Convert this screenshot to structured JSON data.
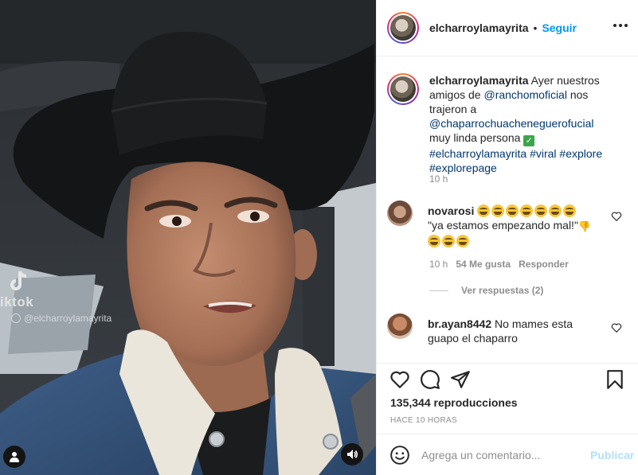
{
  "media": {
    "watermark_word": "iktok",
    "watermark_handle": "@elcharroylamayrita",
    "icons": [
      "tiktok-logo-icon",
      "user-tag-icon",
      "sound-on-icon"
    ]
  },
  "header": {
    "username": "elcharroylamayrita",
    "separator": "•",
    "follow_label": "Seguir"
  },
  "caption": {
    "username": "elcharroylamayrita",
    "text_1": " Ayer nuestros amigos de ",
    "mention_1": "@ranchomoficial",
    "text_2": " nos trajeron a ",
    "mention_2": "@chaparrochuacheneguerofucial",
    "text_3": " muy linda persona ",
    "hashtag_1": "#elcharroylamayrita",
    "hashtag_2": "#viral",
    "hashtag_3": "#explore",
    "hashtag_4": "#explorepage",
    "time": "10 h"
  },
  "comments": [
    {
      "username": "novarosi",
      "text": "\"ya estamos empezando mal!\"",
      "time": "10 h",
      "likes": "54 Me gusta",
      "reply_label": "Responder",
      "view_replies": "Ver respuestas (2)"
    },
    {
      "username": "br.ayan8442",
      "text": " No mames esta guapo el chaparro"
    }
  ],
  "actions": {
    "views": "135,344 reproducciones",
    "ago": "HACE 10 HORAS",
    "icons": [
      "heart-icon",
      "comment-icon",
      "share-icon",
      "bookmark-icon"
    ]
  },
  "add_comment": {
    "placeholder": "Agrega un comentario...",
    "publish_label": "Publicar"
  },
  "colors": {
    "accent": "#0095f6",
    "publish_disabled": "#b2dffc",
    "muted": "#8e8e8e",
    "link": "#00376b"
  }
}
